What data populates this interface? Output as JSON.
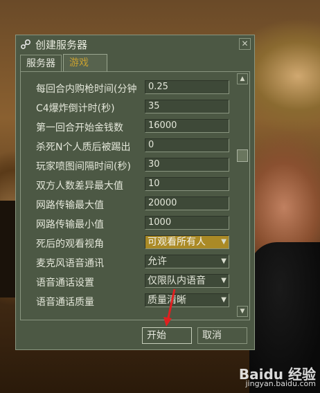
{
  "window": {
    "title": "创建服务器",
    "close_glyph": "✕"
  },
  "tabs": [
    {
      "label": "服务器",
      "active": false
    },
    {
      "label": "游戏",
      "active": true
    }
  ],
  "settings": [
    {
      "label": "每回合内购枪时间(分钟",
      "value": "0.25",
      "kind": "text"
    },
    {
      "label": "C4爆炸倒计时(秒)",
      "value": "35",
      "kind": "text"
    },
    {
      "label": "第一回合开始金钱数",
      "value": "16000",
      "kind": "text"
    },
    {
      "label": "杀死N个人质后被踢出",
      "value": "0",
      "kind": "text"
    },
    {
      "label": "玩家喷图间隔时间(秒)",
      "value": "30",
      "kind": "text"
    },
    {
      "label": "双方人数差异最大值",
      "value": "10",
      "kind": "text"
    },
    {
      "label": "网路传输最大值",
      "value": "20000",
      "kind": "text"
    },
    {
      "label": "网路传输最小值",
      "value": "1000",
      "kind": "text"
    },
    {
      "label": "死后的观看视角",
      "value": "可观看所有人",
      "kind": "select",
      "highlighted": true
    },
    {
      "label": "麦克风语音通讯",
      "value": "允许",
      "kind": "select"
    },
    {
      "label": "语音通话设置",
      "value": "仅限队内语音",
      "kind": "select"
    },
    {
      "label": "语音通话质量",
      "value": "质量清晰",
      "kind": "select"
    }
  ],
  "buttons": {
    "start": "开始",
    "cancel": "取消"
  },
  "watermark": {
    "brand": "Baidu 经验",
    "url": "jingyan.baidu.com"
  },
  "colors": {
    "dialog_bg": "#4c5844",
    "active_tab_text": "#c8a030",
    "highlight_select": "#aa8a26",
    "annotation_arrow": "#e02020"
  }
}
